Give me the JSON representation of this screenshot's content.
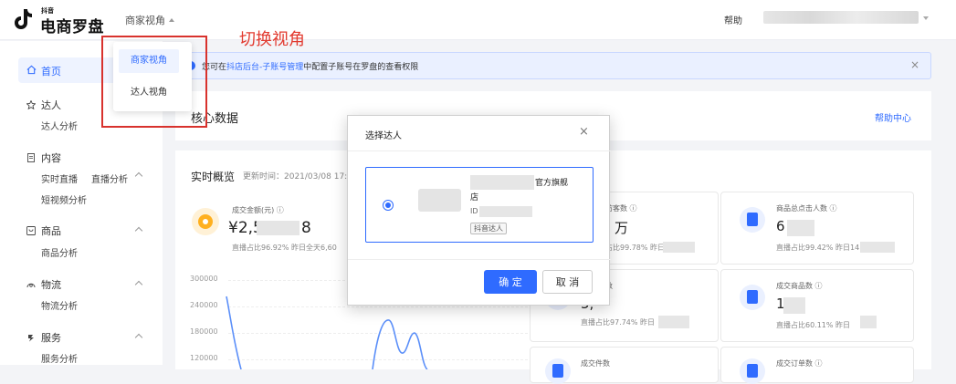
{
  "header": {
    "brand_small": "抖音",
    "brand_title": "电商罗盘",
    "view_switch": "商家视角",
    "help": "帮助"
  },
  "dropdown": {
    "items": [
      "商家视角",
      "达人视角"
    ],
    "annotation": "切换视角"
  },
  "sidebar": {
    "home": "首页",
    "sections": [
      {
        "label": "达人",
        "items": [
          "达人分析"
        ]
      },
      {
        "label": "内容",
        "items": [
          "实时直播",
          "直播分析",
          "短视频分析"
        ]
      },
      {
        "label": "商品",
        "items": [
          "商品分析"
        ]
      },
      {
        "label": "物流",
        "items": [
          "物流分析"
        ]
      },
      {
        "label": "服务",
        "items": [
          "服务分析"
        ]
      }
    ]
  },
  "notice": {
    "prefix": "您可在",
    "link": "抖店后台-子账号管理",
    "suffix": "中配置子账号在罗盘的查看权限",
    "close": "×"
  },
  "core": {
    "title": "核心数据",
    "help_center": "帮助中心"
  },
  "realtime": {
    "title": "实时概览",
    "update_time": "更新时间：2021/03/08 17:1",
    "gmv": {
      "label": "成交金额(元) ⓘ",
      "value_prefix": "¥2,5",
      "value_suffix": "8",
      "sub": "直播占比96.92%  昨日全天6,60"
    },
    "chart_y_ticks": [
      "300000",
      "240000",
      "180000",
      "120000"
    ],
    "metrics": [
      {
        "label": "访客数 ⓘ",
        "value": "万",
        "sub": "占比99.78%  昨日"
      },
      {
        "label": "商品总点击人数 ⓘ",
        "value": "6",
        "sub": "直播占比99.42%  昨日14"
      },
      {
        "label": "数",
        "value": "5,",
        "sub": "直播占比97.74%  昨日"
      },
      {
        "label": "成交商品数 ⓘ",
        "value": "1",
        "sub": "直播占比60.11%  昨日"
      },
      {
        "label": "成交件数",
        "value": "",
        "sub": ""
      },
      {
        "label": "成交订单数 ⓘ",
        "value": "",
        "sub": ""
      }
    ]
  },
  "modal": {
    "title": "选择达人",
    "close": "×",
    "option_name_tail": "官方旗舰",
    "option_name_line2": "店",
    "option_id_label": "ID",
    "option_tag": "抖音达人",
    "confirm": "确 定",
    "cancel": "取 消"
  }
}
